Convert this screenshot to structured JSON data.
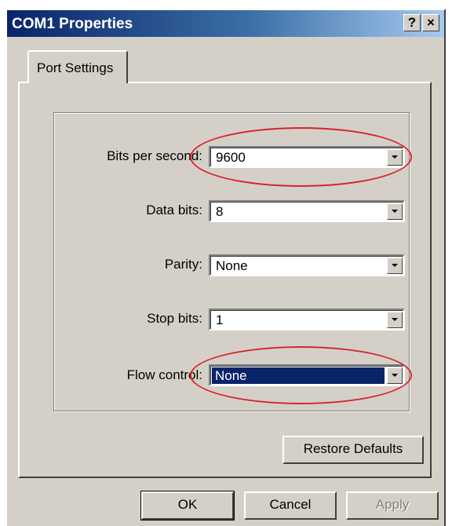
{
  "window": {
    "title": "COM1 Properties",
    "help_button": "?",
    "close_button": "×"
  },
  "tabs": [
    {
      "label": "Port Settings",
      "active": true
    }
  ],
  "fields": {
    "bits_per_second": {
      "label": "Bits per second:",
      "value": "9600",
      "highlighted": true
    },
    "data_bits": {
      "label": "Data bits:",
      "value": "8"
    },
    "parity": {
      "label": "Parity:",
      "value": "None"
    },
    "stop_bits": {
      "label": "Stop bits:",
      "value": "1"
    },
    "flow_control": {
      "label": "Flow control:",
      "value": "None",
      "selected": true,
      "highlighted": true
    }
  },
  "buttons": {
    "restore_defaults": "Restore Defaults",
    "ok": "OK",
    "cancel": "Cancel",
    "apply": "Apply"
  },
  "colors": {
    "dialog_face": "#d4d0c8",
    "titlebar_start": "#0a246a",
    "selection": "#0a246a",
    "annotation_ellipse": "#d8232a"
  }
}
